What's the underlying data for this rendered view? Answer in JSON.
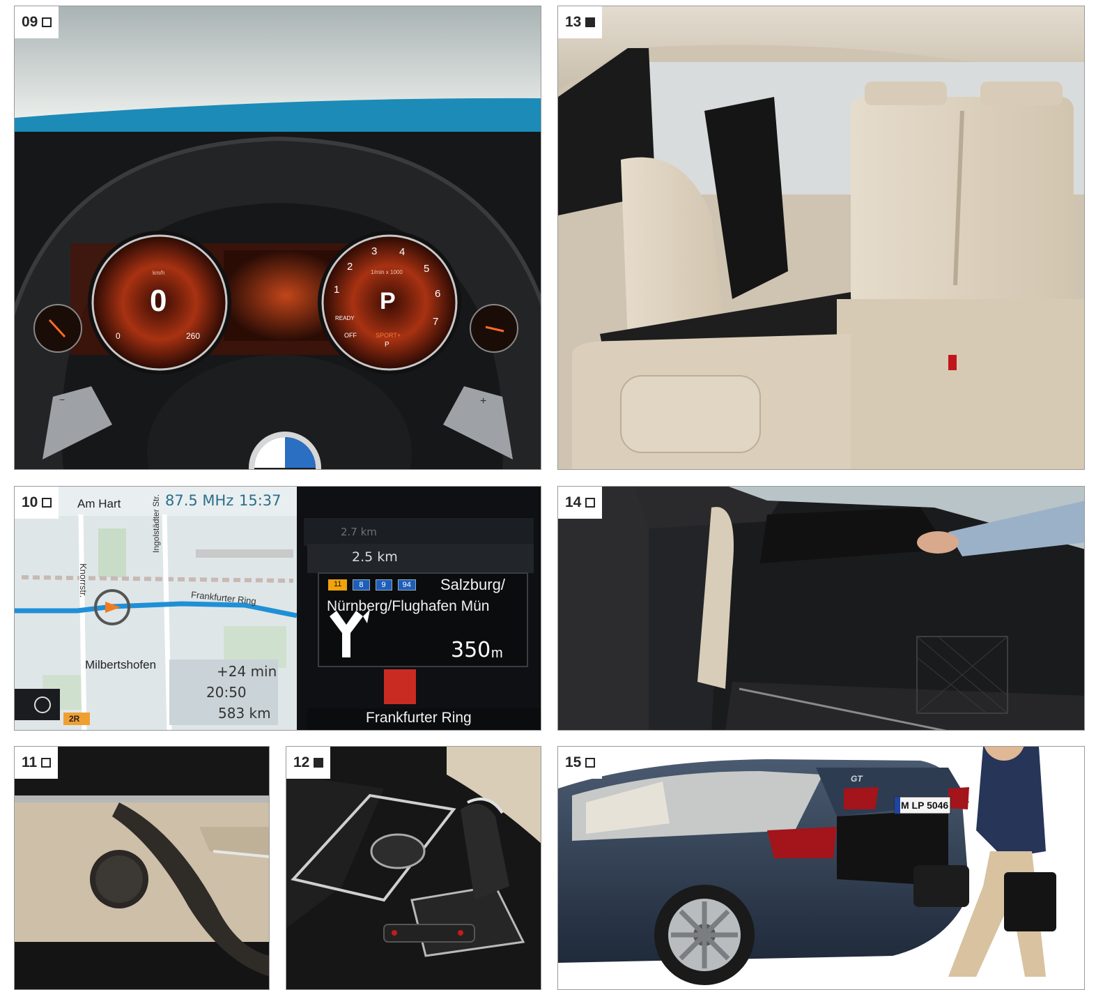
{
  "tiles": {
    "t09": {
      "number": "09",
      "marker": "empty"
    },
    "t13": {
      "number": "13",
      "marker": "filled"
    },
    "t10": {
      "number": "10",
      "marker": "empty"
    },
    "t14": {
      "number": "14",
      "marker": "empty"
    },
    "t11": {
      "number": "11",
      "marker": "empty"
    },
    "t12": {
      "number": "12",
      "marker": "filled"
    },
    "t15": {
      "number": "15",
      "marker": "empty"
    }
  },
  "cluster": {
    "speed_value": "0",
    "speed_unit": "km/h",
    "speed_min": "0",
    "speed_max": "260",
    "gear": "P",
    "rpm_unit": "1/min x 1000",
    "rpm_ticks": [
      "1",
      "2",
      "3",
      "4",
      "5",
      "6",
      "7"
    ],
    "ready": "READY",
    "off": "OFF",
    "mode": "SPORT+",
    "mode_gear": "P",
    "paddle_minus": "−",
    "paddle_plus": "+"
  },
  "nav": {
    "radio": "87.5 MHz",
    "clock": "15:37",
    "street_top": "Am Hart",
    "street_vertical": "Ingolstädter Str.",
    "street_knorr": "Knorrstr.",
    "street_ring": "Frankfurter Ring",
    "district": "Milbertshofen",
    "delay": "+24 min",
    "arrival": "20:50",
    "remaining": "583 km",
    "road_badge": "2R",
    "dist_far": "2.7 km",
    "dist_near": "2.5 km",
    "exit_badges": [
      "11",
      "8",
      "9",
      "94"
    ],
    "exit_line1": "Salzburg/",
    "exit_line2": "Nürnberg/Flughafen Mün",
    "exit_distance": "350",
    "exit_distance_unit": "m",
    "current_road": "Frankfurter Ring"
  },
  "car": {
    "plate": "M LP 5046",
    "model_badge": "GT",
    "brand_letters": "BMW"
  },
  "colors": {
    "accent_orange": "#d4501c",
    "nav_blue": "#1f90d6",
    "leather": "#dcd0bd",
    "paint_blue": "#2e3f58"
  }
}
